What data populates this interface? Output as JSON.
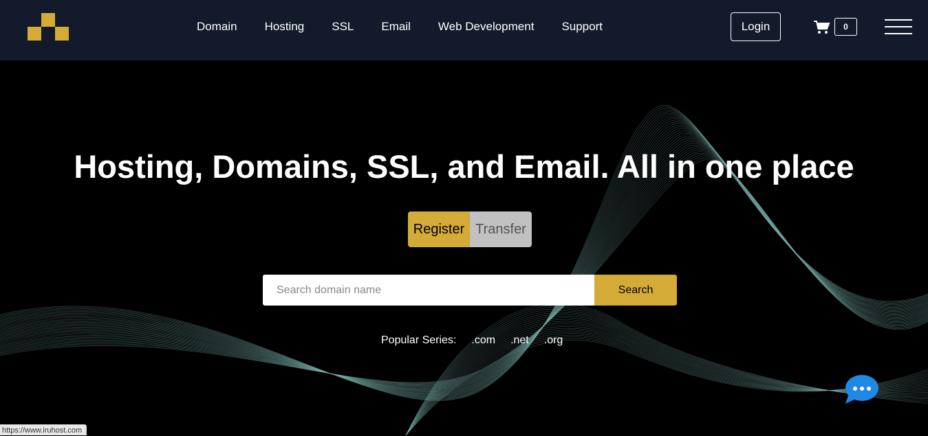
{
  "header": {
    "logo_icon": "pixel-blocks-logo",
    "nav": [
      "Domain",
      "Hosting",
      "SSL",
      "Email",
      "Web Development",
      "Support"
    ],
    "login_label": "Login",
    "cart_icon": "shopping-cart-icon",
    "cart_count": "0",
    "menu_icon": "hamburger-menu-icon"
  },
  "hero": {
    "title": "Hosting, Domains, SSL, and Email. All in one place",
    "toggle": {
      "register_label": "Register",
      "transfer_label": "Transfer"
    },
    "search": {
      "placeholder": "Search domain name",
      "button_label": "Search"
    },
    "popular_label": "Popular Series:",
    "popular_tlds": [
      ".com",
      ".net",
      ".org"
    ]
  },
  "chat_icon": "chat-bubble-icon",
  "status_bar_url": "https://www.iruhost.com",
  "colors": {
    "accent": "#d4ab36",
    "header_bg": "#131a2b",
    "chat": "#1e88e5",
    "toggle_inactive": "#c1c1c1"
  }
}
